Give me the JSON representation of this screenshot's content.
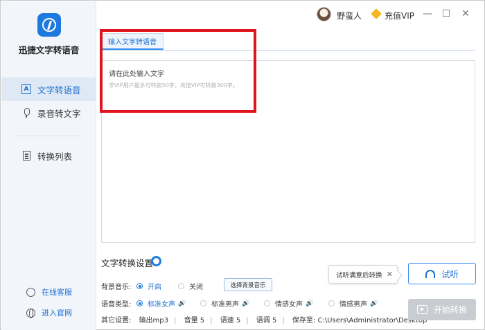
{
  "app": {
    "name": "迅捷文字转语音"
  },
  "sidebar": {
    "items": [
      {
        "label": "文字转语音",
        "active": true,
        "icon": "text-a-icon"
      },
      {
        "label": "录音转文字",
        "active": false,
        "icon": "microphone-icon"
      },
      {
        "label": "转换列表",
        "active": false,
        "icon": "document-list-icon"
      }
    ],
    "links": [
      {
        "label": "在线客服",
        "icon": "headset-icon"
      },
      {
        "label": "进入官网",
        "icon": "globe-icon"
      }
    ]
  },
  "titlebar": {
    "username": "野蛮人",
    "vip_label": "充值VIP",
    "controls": [
      "minimize",
      "maximize",
      "close"
    ]
  },
  "main": {
    "tab_label": "输入文字转语音",
    "editor": {
      "prompt": "请在此处输入文字",
      "hint": "非VIP用户最多可转换50字，充值VIP可转换300字。"
    }
  },
  "settings": {
    "title": "文字转换设置",
    "bgm": {
      "label": "背景音乐:",
      "options": [
        {
          "label": "开启",
          "selected": true
        },
        {
          "label": "关闭",
          "selected": false
        }
      ],
      "button_label": "选择背景音乐"
    },
    "voice": {
      "label": "语音类型:",
      "options": [
        {
          "label": "标准女声",
          "selected": true
        },
        {
          "label": "标准男声",
          "selected": false
        },
        {
          "label": "情感女声",
          "selected": false
        },
        {
          "label": "情感男声",
          "selected": false
        }
      ]
    },
    "other": {
      "label": "其它设置:",
      "output": "输出mp3",
      "volume": "音量 5",
      "speed": "语速 5",
      "pitch": "语调 5",
      "save_to": "保存至: C:\\Users\\Administrator\\Desktop"
    }
  },
  "actions": {
    "tooltip": "试听满意后转换",
    "listen_label": "试听",
    "start_label": "开始转换"
  },
  "colors": {
    "accent": "#1f7ae0",
    "highlight_box": "#e0141e",
    "sidebar_bg": "#f2f6fb",
    "disabled_button": "#c9cdd2"
  }
}
